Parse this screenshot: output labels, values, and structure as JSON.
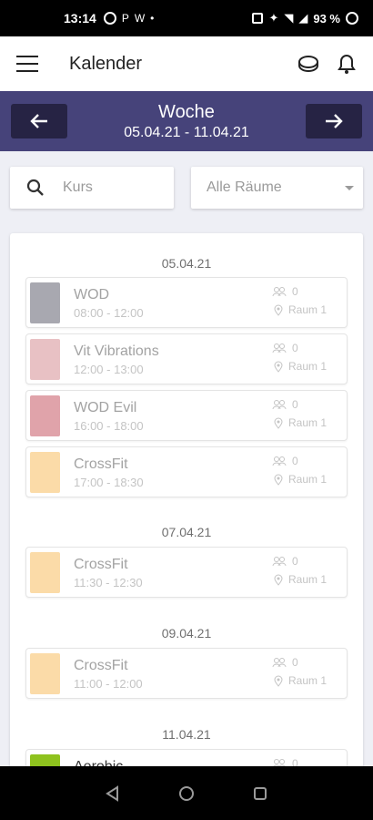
{
  "status": {
    "time": "13:14",
    "left_icons": [
      "P",
      "W",
      "•"
    ],
    "battery": "93 %"
  },
  "app": {
    "title": "Kalender"
  },
  "week": {
    "title": "Woche",
    "range": "05.04.21 - 11.04.21"
  },
  "filters": {
    "search_placeholder": "Kurs",
    "room_selected": "Alle Räume"
  },
  "days": [
    {
      "date": "05.04.21",
      "events": [
        {
          "name": "WOD",
          "time": "08:00 - 12:00",
          "count": "0",
          "room": "Raum 1",
          "color": "#a8a8b0"
        },
        {
          "name": "Vit Vibrations",
          "time": "12:00 - 13:00",
          "count": "0",
          "room": "Raum 1",
          "color": "#e8c1c4"
        },
        {
          "name": "WOD Evil",
          "time": "16:00 - 18:00",
          "count": "0",
          "room": "Raum 1",
          "color": "#e0a3aa"
        },
        {
          "name": "CrossFit",
          "time": "17:00 - 18:30",
          "count": "0",
          "room": "Raum 1",
          "color": "#fbdba8"
        }
      ]
    },
    {
      "date": "07.04.21",
      "events": [
        {
          "name": "CrossFit",
          "time": "11:30 - 12:30",
          "count": "0",
          "room": "Raum 1",
          "color": "#fbdba8"
        }
      ]
    },
    {
      "date": "09.04.21",
      "events": [
        {
          "name": "CrossFit",
          "time": "11:00 - 12:00",
          "count": "0",
          "room": "Raum 1",
          "color": "#fbdba8"
        }
      ]
    },
    {
      "date": "11.04.21",
      "events": [
        {
          "name": "Aerobic",
          "time": "",
          "count": "0",
          "room": "",
          "color": "#8ec21e"
        }
      ]
    }
  ]
}
